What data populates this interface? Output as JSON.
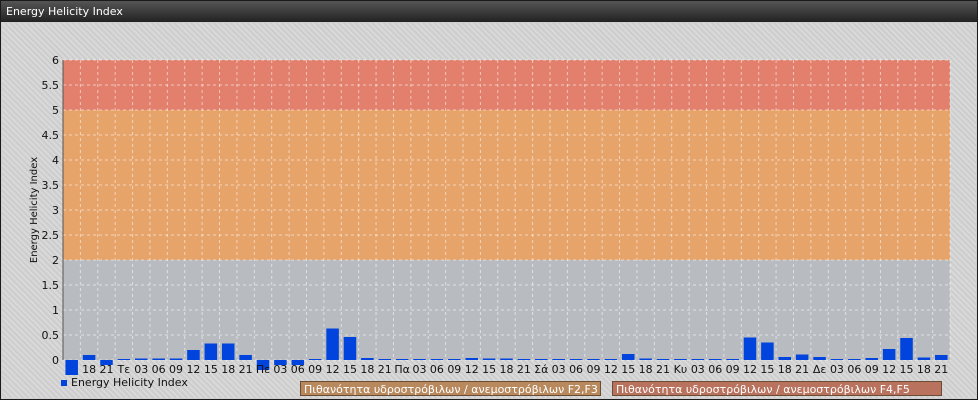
{
  "window": {
    "title": "Energy Helicity Index"
  },
  "legend": {
    "series_label": "Energy Helicity Index",
    "band1_label": "Πιθανότητα υδροστρόβιλων / ανεμοστρόβιλων F2,F3",
    "band2_label": "Πιθανότητα υδροστρόβιλων / ανεμοστρόβιλων F4,F5"
  },
  "colors": {
    "bar": "#0044dd",
    "band_low": "#b8bcc0",
    "band_mid": "#e6a36a",
    "band_high": "#e2806d"
  },
  "chart_data": {
    "type": "bar",
    "title": "",
    "xlabel": "",
    "ylabel": "Energy Helicity Index",
    "ylim": [
      0,
      6
    ],
    "yticks": [
      "0",
      "0.5",
      "1",
      "1.5",
      "2",
      "2.5",
      "3",
      "3.5",
      "4",
      "4.5",
      "5",
      "5.5",
      "6"
    ],
    "grid": true,
    "legend": "bottom-left",
    "bands": [
      {
        "from": 0,
        "to": 2,
        "color": "#b8bcc0"
      },
      {
        "from": 2,
        "to": 5,
        "color": "#e6a36a"
      },
      {
        "from": 5,
        "to": 6,
        "color": "#e2806d"
      }
    ],
    "categories": [
      "15",
      "18",
      "21",
      "Τε",
      "03",
      "06",
      "09",
      "12",
      "15",
      "18",
      "21",
      "Πε",
      "03",
      "06",
      "09",
      "12",
      "15",
      "18",
      "21",
      "Πα",
      "03",
      "06",
      "09",
      "12",
      "15",
      "18",
      "21",
      "Σά",
      "03",
      "06",
      "09",
      "12",
      "15",
      "18",
      "21",
      "Κυ",
      "03",
      "06",
      "09",
      "12",
      "15",
      "18",
      "21",
      "Δε",
      "03",
      "06",
      "09",
      "12",
      "15",
      "18",
      "21"
    ],
    "tick_labels": [
      "",
      "18",
      "21",
      "Τε",
      "03",
      "06",
      "09",
      "12",
      "15",
      "18",
      "21",
      "Πε",
      "03",
      "06",
      "09",
      "12",
      "15",
      "18",
      "21",
      "Πα",
      "03",
      "06",
      "09",
      "12",
      "15",
      "18",
      "21",
      "Σά",
      "03",
      "06",
      "09",
      "12",
      "15",
      "18",
      "21",
      "Κυ",
      "03",
      "06",
      "09",
      "12",
      "15",
      "18",
      "21",
      "Δε",
      "03",
      "06",
      "09",
      "12",
      "15",
      "18",
      "21"
    ],
    "series": [
      {
        "name": "Energy Helicity Index",
        "values": [
          -0.3,
          0.1,
          -0.1,
          0.02,
          0.03,
          0.03,
          0.03,
          0.2,
          0.33,
          0.33,
          0.1,
          -0.2,
          -0.1,
          -0.1,
          0.02,
          0.63,
          0.46,
          0.04,
          0.02,
          0.02,
          0.02,
          0.02,
          0.02,
          0.04,
          0.03,
          0.03,
          0.02,
          0.02,
          0.02,
          0.02,
          0.02,
          0.02,
          0.12,
          0.03,
          0.02,
          0.02,
          0.02,
          0.02,
          0.02,
          0.45,
          0.35,
          0.06,
          0.11,
          0.06,
          0.02,
          0.02,
          0.04,
          0.22,
          0.44,
          0.05,
          0.1
        ]
      }
    ]
  }
}
